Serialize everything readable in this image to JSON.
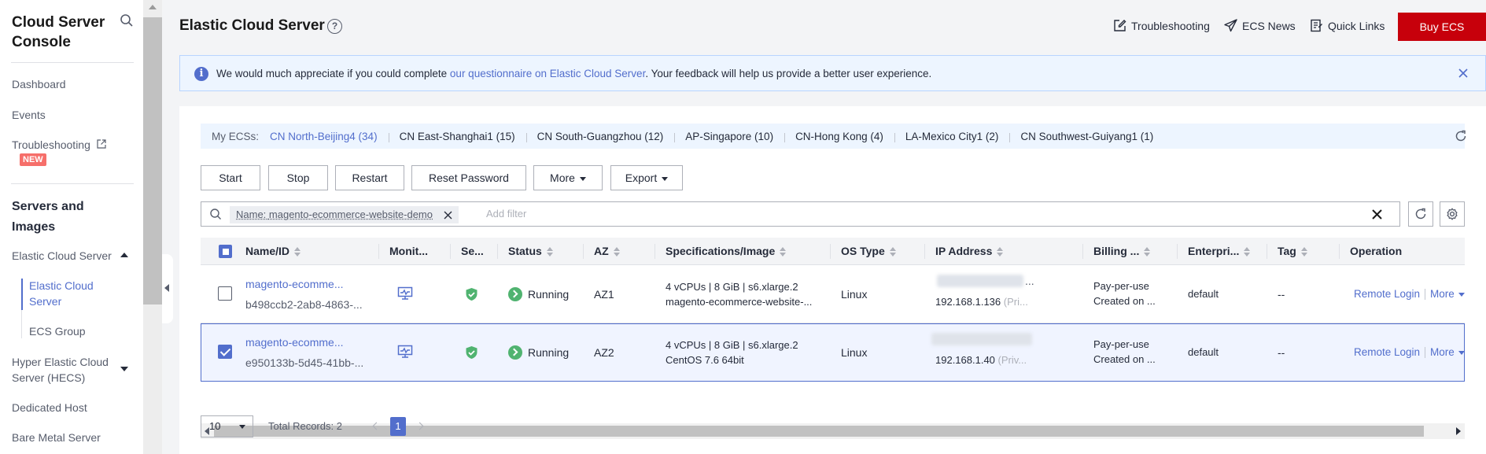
{
  "sidebar": {
    "title_line1": "Cloud Server",
    "title_line2": "Console",
    "items": {
      "dashboard": "Dashboard",
      "events": "Events",
      "troubleshooting": "Troubleshooting",
      "new_badge": "NEW"
    },
    "section_line1": "Servers and",
    "section_line2": "Images",
    "ecs_group_label": "Elastic Cloud Server",
    "ecs_sub_active_line1": "Elastic Cloud",
    "ecs_sub_active_line2": "Server",
    "ecs_sub_group": "ECS Group",
    "hecs_line1": "Hyper Elastic Cloud",
    "hecs_line2": "Server (HECS)",
    "dedicated_host": "Dedicated Host",
    "bare_metal": "Bare Metal Server"
  },
  "header": {
    "title": "Elastic Cloud Server",
    "help_glyph": "?",
    "links": {
      "troubleshooting": "Troubleshooting",
      "ecs_news": "ECS News",
      "quick_links": "Quick Links"
    },
    "buy_button": "Buy ECS"
  },
  "notice": {
    "icon_glyph": "i",
    "text_before": "We would much appreciate if you could complete ",
    "link_text": "our questionnaire on Elastic Cloud Server",
    "text_after": ". Your feedback will help us provide a better user experience."
  },
  "regions": {
    "label": "My ECSs:",
    "items": [
      "CN North-Beijing4 (34)",
      "CN East-Shanghai1 (15)",
      "CN South-Guangzhou (12)",
      "AP-Singapore (10)",
      "CN-Hong Kong (4)",
      "LA-Mexico City1 (2)",
      "CN Southwest-Guiyang1 (1)"
    ]
  },
  "toolbar": {
    "start": "Start",
    "stop": "Stop",
    "restart": "Restart",
    "reset_password": "Reset Password",
    "more": "More",
    "export": "Export"
  },
  "filter": {
    "tag_prefix": "Name: ",
    "tag_value": "magento-ecommerce-website-demo",
    "placeholder": "Add filter"
  },
  "table": {
    "headers": {
      "name": "Name/ID",
      "monitoring": "Monit...",
      "security": "Se...",
      "status": "Status",
      "az": "AZ",
      "specs": "Specifications/Image",
      "os": "OS Type",
      "ip": "IP Address",
      "billing": "Billing ...",
      "enterprise": "Enterpri...",
      "tag": "Tag",
      "operation": "Operation"
    },
    "rows": [
      {
        "name": "magento-ecomme...",
        "id": "b498ccb2-2ab8-4863-...",
        "status": "Running",
        "az": "AZ1",
        "spec": "4 vCPUs | 8 GiB | s6.xlarge.2",
        "image": "magento-ecommerce-website-...",
        "os": "Linux",
        "ip_public_suffix": "...",
        "ip_private": "192.168.1.136",
        "ip_private_label": "(Pri...",
        "billing": "Pay-per-use",
        "billing_created": "Created on ...",
        "enterprise": "default",
        "tag": "--",
        "op_remote": "Remote Login",
        "op_more": "More",
        "selected": false
      },
      {
        "name": "magento-ecomme...",
        "id": "e950133b-5d45-41bb-...",
        "status": "Running",
        "az": "AZ2",
        "spec": "4 vCPUs | 8 GiB | s6.xlarge.2",
        "image": "CentOS 7.6 64bit",
        "os": "Linux",
        "ip_public_suffix": "",
        "ip_private": "192.168.1.40",
        "ip_private_label": "(Priv...",
        "billing": "Pay-per-use",
        "billing_created": "Created on ...",
        "enterprise": "default",
        "tag": "--",
        "op_remote": "Remote Login",
        "op_more": "More",
        "selected": true
      }
    ]
  },
  "pagination": {
    "page_size": "10",
    "total": "Total Records: 2",
    "current_page": "1"
  },
  "colors": {
    "brand_red": "#c7000b",
    "accent_blue": "#526ecc",
    "running_green": "#50b370",
    "new_badge": "#f66f6a"
  }
}
